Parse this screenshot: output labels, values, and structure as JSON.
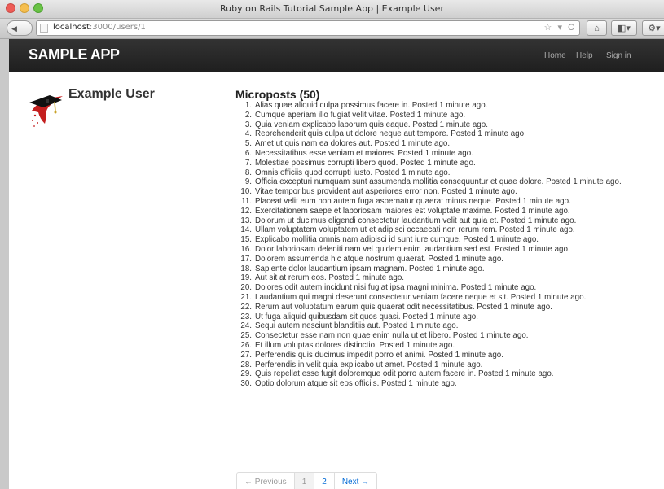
{
  "browser": {
    "window_title": "Ruby on Rails Tutorial Sample App | Example User",
    "url_host": "localhost",
    "url_path": ":3000/users/1",
    "back_glyph": "◀",
    "url_action_glyphs": "☆ ▾ C",
    "home_glyph": "⌂",
    "bookmark_glyph": "◧▾",
    "tools_glyph": "⚙▾"
  },
  "header": {
    "logo": "SAMPLE APP",
    "nav": {
      "home": "Home",
      "help": "Help",
      "signin": "Sign in"
    }
  },
  "user": {
    "name": "Example User"
  },
  "microposts": {
    "heading": "Microposts (50)",
    "posted_suffix": "Posted 1 minute ago.",
    "items": [
      {
        "num": "1.",
        "content": "Alias quae aliquid culpa possimus facere in."
      },
      {
        "num": "2.",
        "content": "Cumque aperiam illo fugiat velit vitae."
      },
      {
        "num": "3.",
        "content": "Quia veniam explicabo laborum quis eaque."
      },
      {
        "num": "4.",
        "content": "Reprehenderit quis culpa ut dolore neque aut tempore."
      },
      {
        "num": "5.",
        "content": "Amet ut quis nam ea dolores aut."
      },
      {
        "num": "6.",
        "content": "Necessitatibus esse veniam et maiores."
      },
      {
        "num": "7.",
        "content": "Molestiae possimus corrupti libero quod."
      },
      {
        "num": "8.",
        "content": "Omnis officiis quod corrupti iusto."
      },
      {
        "num": "9.",
        "content": "Officia excepturi numquam sunt assumenda mollitia consequuntur et quae dolore."
      },
      {
        "num": "10.",
        "content": "Vitae temporibus provident aut asperiores error non."
      },
      {
        "num": "11.",
        "content": "Placeat velit eum non autem fuga aspernatur quaerat minus neque."
      },
      {
        "num": "12.",
        "content": "Exercitationem saepe et laboriosam maiores est voluptate maxime."
      },
      {
        "num": "13.",
        "content": "Dolorum ut ducimus eligendi consectetur laudantium velit aut quia et."
      },
      {
        "num": "14.",
        "content": "Ullam voluptatem voluptatem ut et adipisci occaecati non rerum rem."
      },
      {
        "num": "15.",
        "content": "Explicabo mollitia omnis nam adipisci id sunt iure cumque."
      },
      {
        "num": "16.",
        "content": "Dolor laboriosam deleniti nam vel quidem enim laudantium sed est."
      },
      {
        "num": "17.",
        "content": "Dolorem assumenda hic atque nostrum quaerat."
      },
      {
        "num": "18.",
        "content": "Sapiente dolor laudantium ipsam magnam."
      },
      {
        "num": "19.",
        "content": "Aut sit at rerum eos."
      },
      {
        "num": "20.",
        "content": "Dolores odit autem incidunt nisi fugiat ipsa magni minima."
      },
      {
        "num": "21.",
        "content": "Laudantium qui magni deserunt consectetur veniam facere neque et sit."
      },
      {
        "num": "22.",
        "content": "Rerum aut voluptatum earum quis quaerat odit necessitatibus."
      },
      {
        "num": "23.",
        "content": "Ut fuga aliquid quibusdam sit quos quasi."
      },
      {
        "num": "24.",
        "content": "Sequi autem nesciunt blanditiis aut."
      },
      {
        "num": "25.",
        "content": "Consectetur esse nam non quae enim nulla ut et libero."
      },
      {
        "num": "26.",
        "content": "Et illum voluptas dolores distinctio."
      },
      {
        "num": "27.",
        "content": "Perferendis quis ducimus impedit porro et animi."
      },
      {
        "num": "28.",
        "content": "Perferendis in velit quia explicabo ut amet."
      },
      {
        "num": "29.",
        "content": "Quis repellat esse fugit doloremque odit porro autem facere in."
      },
      {
        "num": "30.",
        "content": "Optio dolorum atque sit eos officiis."
      }
    ]
  },
  "pagination": {
    "previous": "← Previous",
    "pages": [
      "1",
      "2"
    ],
    "current_page": "1",
    "next": "Next →"
  }
}
